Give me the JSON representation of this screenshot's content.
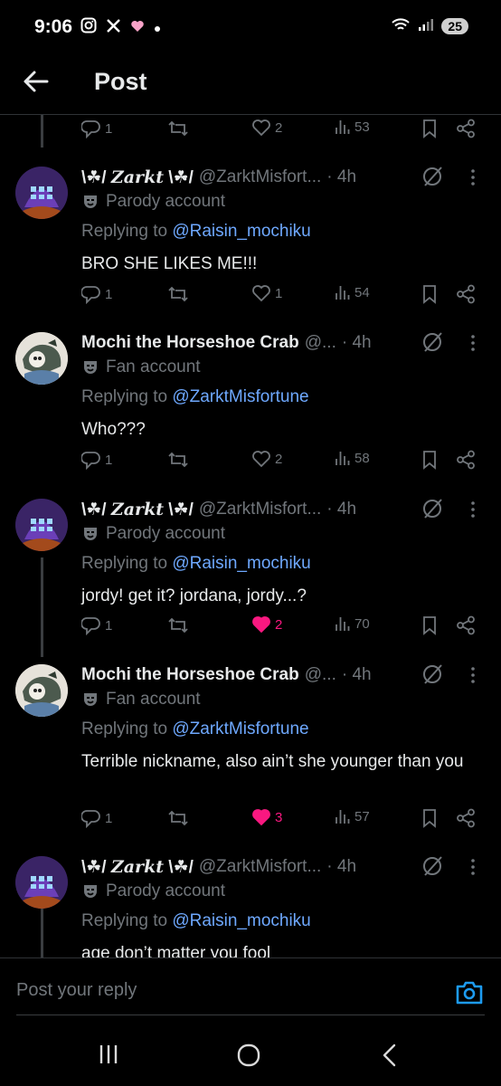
{
  "status_bar": {
    "time": "9:06",
    "battery": "25"
  },
  "header": {
    "title": "Post"
  },
  "top_action_bar": {
    "replies": "1",
    "reposts": "",
    "likes": "2",
    "views": "53"
  },
  "posts": [
    {
      "display_name": "Zarkt",
      "name_decor_left": "\\☘/",
      "name_decor_right": "\\☘/",
      "handle": "@ZarktMisfort...",
      "time": "· 4h",
      "label": "Parody account",
      "replying_prefix": "Replying to",
      "replying_to": "@Raisin_mochiku",
      "text": "BRO SHE LIKES ME!!!",
      "replies": "1",
      "likes": "1",
      "views": "54",
      "liked": false
    },
    {
      "display_name": "Mochi the Horseshoe Crab",
      "handle": "@...",
      "time": "· 4h",
      "label": "Fan account",
      "replying_prefix": "Replying to",
      "replying_to": "@ZarktMisfortune",
      "text": "Who???",
      "replies": "1",
      "likes": "2",
      "views": "58",
      "liked": false
    },
    {
      "display_name": "Zarkt",
      "name_decor_left": "\\☘/",
      "name_decor_right": "\\☘/",
      "handle": "@ZarktMisfort...",
      "time": "· 4h",
      "label": "Parody account",
      "replying_prefix": "Replying to",
      "replying_to": "@Raisin_mochiku",
      "text": "jordy! get it? jordana, jordy...?",
      "replies": "1",
      "likes": "2",
      "views": "70",
      "liked": true
    },
    {
      "display_name": "Mochi the Horseshoe Crab",
      "handle": "@...",
      "time": "· 4h",
      "label": "Fan account",
      "replying_prefix": "Replying to",
      "replying_to": "@ZarktMisfortune",
      "text": "Terrible nickname, also ain’t she younger than you",
      "replies": "1",
      "likes": "3",
      "views": "57",
      "liked": true
    },
    {
      "display_name": "Zarkt",
      "name_decor_left": "\\☘/",
      "name_decor_right": "\\☘/",
      "handle": "@ZarktMisfort...",
      "time": "· 4h",
      "label": "Parody account",
      "replying_prefix": "Replying to",
      "replying_to": "@Raisin_mochiku",
      "text": "age don’t matter you fool"
    }
  ],
  "reply_box": {
    "placeholder": "Post your reply"
  },
  "colors": {
    "accent": "#1d9bf0",
    "mention": "#6ea8fe",
    "like": "#f91880",
    "muted": "#71767b"
  },
  "icons": [
    "back-arrow-icon",
    "reply-icon",
    "repost-icon",
    "heart-icon",
    "views-icon",
    "bookmark-icon",
    "share-icon",
    "grok-icon",
    "more-icon",
    "mask-icon",
    "camera-icon"
  ]
}
